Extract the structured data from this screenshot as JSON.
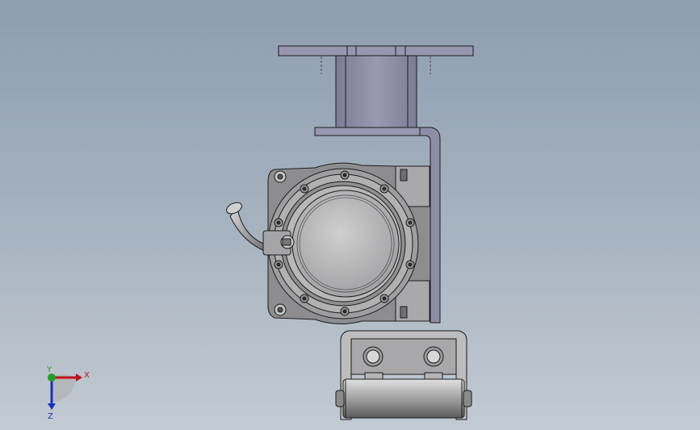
{
  "viewport": {
    "background_top": "#8d9eb0",
    "background_bottom": "#c3cbd3",
    "model_fill": "#8c8c8f",
    "model_light_fill": "#bdbdbe",
    "edge_color": "#1c1c1c",
    "bracket_fill": "#8e8da6"
  },
  "triad": {
    "x_label": "X",
    "y_label": "Y",
    "z_label": "Z",
    "x_color": "#c0121c",
    "y_color": "#20a020",
    "z_color": "#1a2fc0"
  },
  "model": {
    "parts": [
      "mounting-bracket",
      "motor-housing",
      "motor-face-cover",
      "cable-gland",
      "side-bracket",
      "roller-carriage"
    ]
  }
}
